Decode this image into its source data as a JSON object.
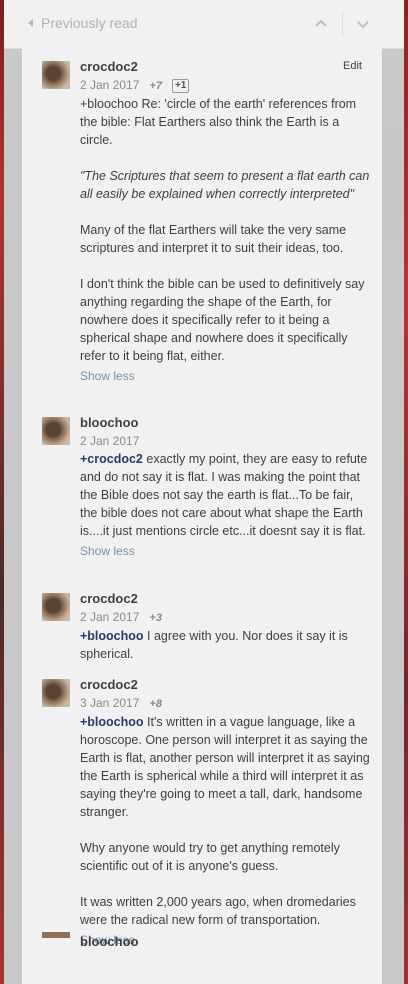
{
  "header": {
    "previously_read": "Previously read",
    "up_icon": "chevron-up-icon",
    "down_icon": "chevron-down-icon"
  },
  "comments": [
    {
      "author": "crocdoc2",
      "date": "2 Jan 2017",
      "votes": "+7",
      "plus_button": "+1",
      "edit": "Edit",
      "paragraphs": [
        "+bloochoo Re: 'circle of the earth' references from the bible: Flat Earthers also think the Earth is a circle.",
        "\"The Scriptures that seem to present a flat earth can all easily be explained when correctly interpreted\"",
        "Many of the flat Earthers will take the very same scriptures and interpret it to suit their ideas, too.",
        "I don't think the bible can be used to definitively say anything regarding the shape of the Earth, for nowhere does it specifically refer to it being a spherical shape and nowhere does it specifically refer to it being flat, either."
      ],
      "show_less": "Show less"
    },
    {
      "author": "bloochoo",
      "date": "2 Jan 2017",
      "mention": "+crocdoc2",
      "text": " exactly my point, they are easy to refute and do not say it is flat. I was making the point that the Bible does not say the earth is flat...To be fair, the bible does not care about what shape the Earth is....it just mentions circle etc...it doesnt say it is flat.",
      "show_less": "Show less"
    },
    {
      "author": "crocdoc2",
      "date": "2 Jan 2017",
      "votes": "+3",
      "mention": "+bloochoo",
      "text": " I agree with you. Nor does it say it is spherical."
    },
    {
      "author": "crocdoc2",
      "date": "3 Jan 2017",
      "votes": "+8",
      "mention": "+bloochoo",
      "text": " It's written in a vague language, like a horoscope. One person will interpret it as saying the Earth is flat, another person will interpret it as saying the Earth is spherical while a third will interpret it as saying they're going to meet a tall, dark, handsome stranger.",
      "paragraphs": [
        "Why anyone would try to get anything remotely scientific out of it is anyone's guess.",
        "It was written 2,000 years ago, when dromedaries were the radical new form of transportation."
      ],
      "show_less": "Show less"
    }
  ],
  "next_author": "bloochoo"
}
